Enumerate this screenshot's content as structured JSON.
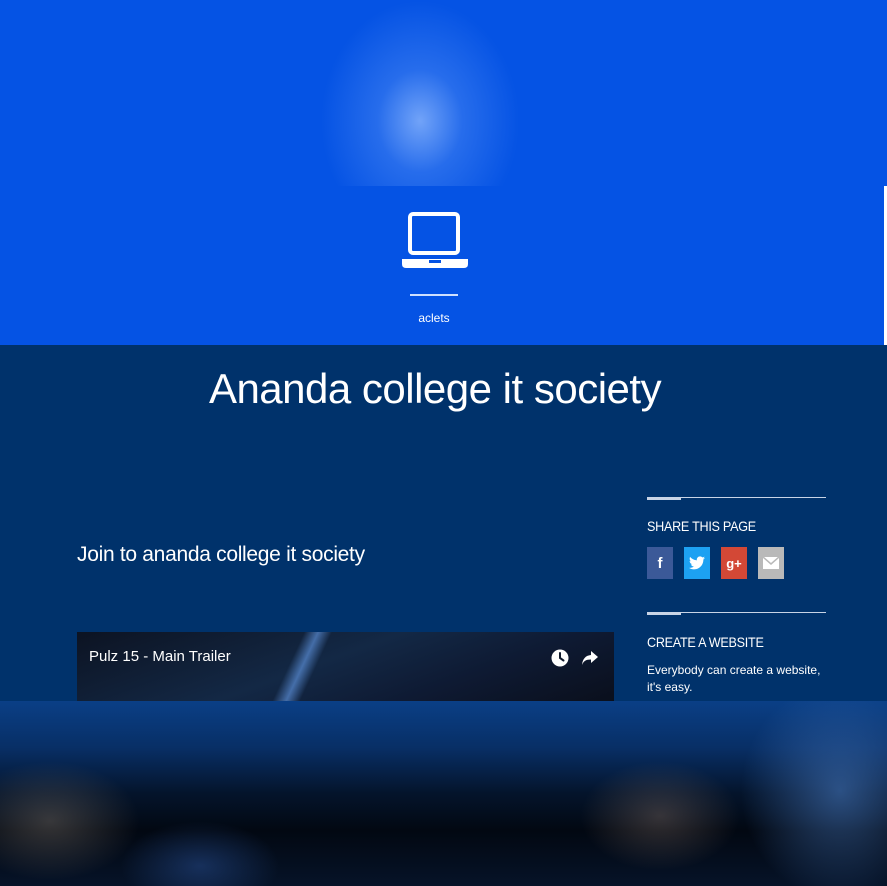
{
  "brand": {
    "logo_icon": "laptop-icon",
    "label": "aclets"
  },
  "page": {
    "title": "Ananda college it society",
    "intro": "Join to ananda college it society"
  },
  "video": {
    "title": "Pulz 15 - Main Trailer",
    "icons": [
      "clock-icon",
      "share-arrow-icon"
    ]
  },
  "sidebar": {
    "share_heading": "SHARE THIS PAGE",
    "share_buttons": [
      {
        "name": "facebook",
        "glyph": "f",
        "color": "#3b5998"
      },
      {
        "name": "twitter",
        "glyph": "",
        "color": "#1da1f2"
      },
      {
        "name": "google-plus",
        "glyph": "g+",
        "color": "#d34836"
      },
      {
        "name": "email",
        "glyph": "",
        "color": "#b9b9b9"
      }
    ],
    "create_heading": "CREATE A WEBSITE",
    "create_text": "Everybody can create a website, it's easy."
  },
  "colors": {
    "header_blue": "#0553e4",
    "main_navy": "#00326b"
  }
}
